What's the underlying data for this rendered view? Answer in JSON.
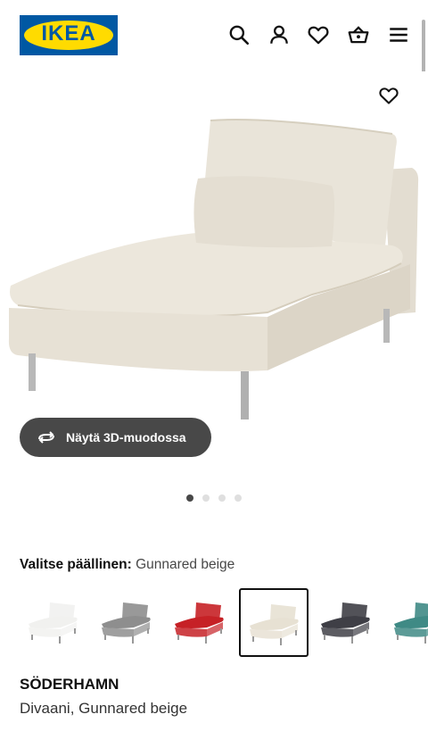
{
  "header": {
    "logo_text": "IKEA",
    "icons": [
      "search-icon",
      "account-icon",
      "favourites-icon",
      "basket-icon",
      "menu-icon"
    ]
  },
  "gallery": {
    "button_3d_label": "Näytä 3D-muodossa",
    "dots_count": 4,
    "active_dot": 1
  },
  "cover": {
    "label": "Valitse päällinen:",
    "selected": "Gunnared beige",
    "options": [
      {
        "color": "#f1f1ef"
      },
      {
        "color": "#8e8e8e"
      },
      {
        "color": "#c62126"
      },
      {
        "color": "#e7e1d3"
      },
      {
        "color": "#3f3f46"
      },
      {
        "color": "#3f8a85"
      }
    ],
    "selected_index": 3
  },
  "product": {
    "name": "SÖDERHAMN",
    "description": "Divaani, Gunnared beige"
  }
}
